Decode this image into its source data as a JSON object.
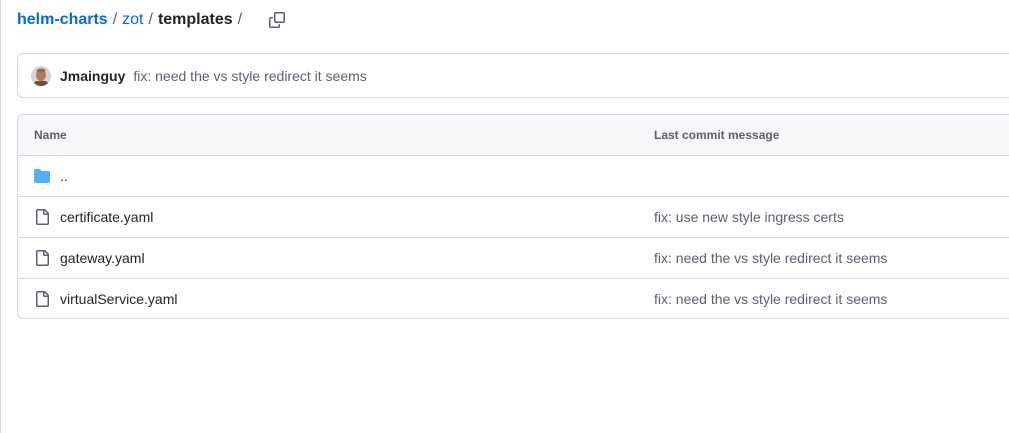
{
  "breadcrumb": {
    "repo": "helm-charts",
    "dir": "zot",
    "current": "templates",
    "separator": "/",
    "copy_icon": "copy-icon"
  },
  "commit": {
    "author": "Jmainguy",
    "message": "fix: need the vs style redirect it seems"
  },
  "table": {
    "headers": {
      "name": "Name",
      "last_commit": "Last commit message"
    },
    "parent_dir": "..",
    "files": [
      {
        "name": "certificate.yaml",
        "commit": "fix: use new style ingress certs",
        "icon": "file-icon"
      },
      {
        "name": "gateway.yaml",
        "commit": "fix: need the vs style redirect it seems",
        "icon": "file-icon"
      },
      {
        "name": "virtualService.yaml",
        "commit": "fix: need the vs style redirect it seems",
        "icon": "file-icon"
      }
    ]
  },
  "colors": {
    "link": "#0969da",
    "text": "#1f2328",
    "muted": "#59636e",
    "border": "#d1d9e0",
    "folder": "#54aeff"
  }
}
